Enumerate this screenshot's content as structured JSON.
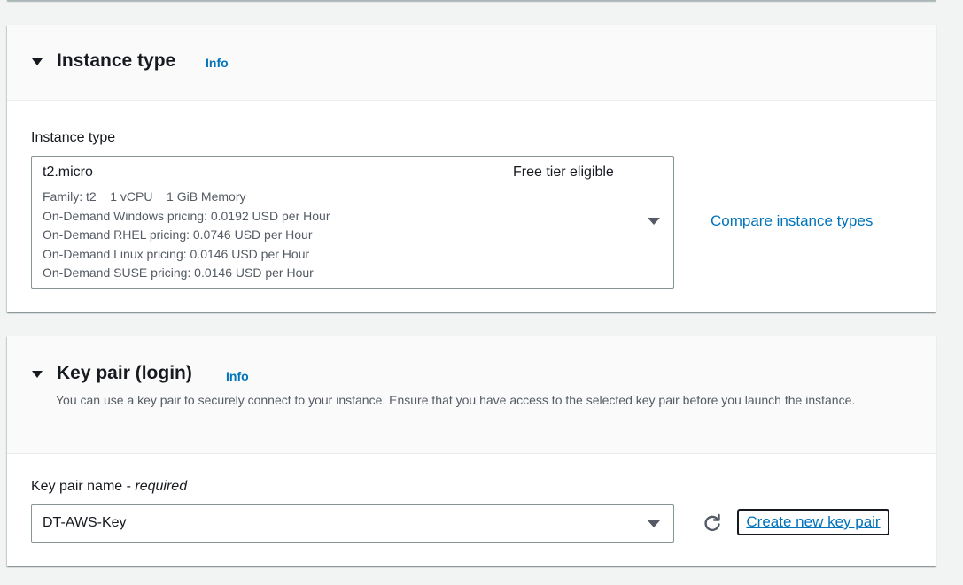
{
  "instance_type_section": {
    "title": "Instance type",
    "info_label": "Info",
    "field_label": "Instance type",
    "selected": {
      "name": "t2.micro",
      "badge": "Free tier eligible",
      "family_line": "Family: t2    1 vCPU    1 GiB Memory",
      "pricing": [
        "On-Demand Windows pricing: 0.0192 USD per Hour",
        "On-Demand RHEL pricing: 0.0746 USD per Hour",
        "On-Demand Linux pricing: 0.0146 USD per Hour",
        "On-Demand SUSE pricing: 0.0146 USD per Hour"
      ]
    },
    "compare_link": "Compare instance types"
  },
  "key_pair_section": {
    "title": "Key pair (login)",
    "info_label": "Info",
    "description": "You can use a key pair to securely connect to your instance. Ensure that you have access to the selected key pair before you launch the instance.",
    "field_label": "Key pair name - ",
    "field_required": "required",
    "selected_value": "DT-AWS-Key",
    "create_link": "Create new key pair"
  },
  "icons": {
    "collapse": "caret-down-icon",
    "dropdown": "dropdown-caret-icon",
    "refresh": "refresh-icon"
  },
  "colors": {
    "link": "#0073bb",
    "text": "#16191f",
    "secondary_text": "#545b64",
    "background": "#f2f3f3"
  }
}
